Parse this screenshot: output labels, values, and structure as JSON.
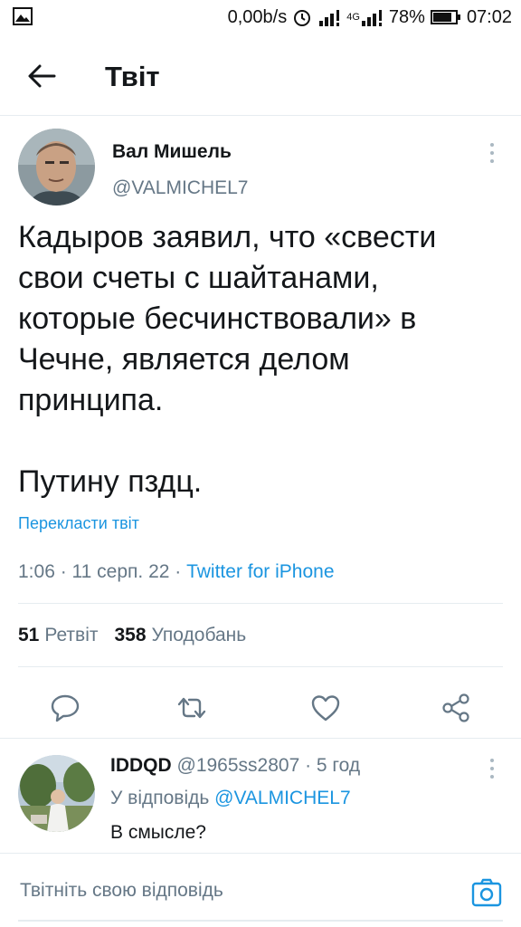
{
  "status_bar": {
    "speed": "0,00b/s",
    "network_label": "4G",
    "battery_percent": "78%",
    "time": "07:02",
    "icons": [
      "image-icon",
      "alarm-icon",
      "signal-icon",
      "signal-4g-icon",
      "battery-icon"
    ]
  },
  "header": {
    "title": "Твіт",
    "back_icon": "arrow-left-icon"
  },
  "tweet": {
    "author_name": "Вал Мишель",
    "author_handle": "@VALMICHEL7",
    "text": "Кадыров заявил, что «свести свои счеты с шайтанами, которые бесчинствовали» в Чечне, является делом принципа.\n\nПутину пздц.",
    "translate_label": "Перекласти твіт",
    "meta_time": "1:06 · 11 серп. 22 · ",
    "meta_client": "Twitter for iPhone",
    "retweets_count": "51",
    "retweets_label": "Ретвіт",
    "likes_count": "358",
    "likes_label": "Уподобань",
    "action_icons": [
      "reply-icon",
      "retweet-icon",
      "like-icon",
      "share-icon"
    ]
  },
  "reply": {
    "author_name": "IDDQD",
    "author_handle_time": " @1965ss2807 · 5 год",
    "in_reply_prefix": "У відповідь ",
    "in_reply_mention": "@VALMICHEL7",
    "text": "В смысле?"
  },
  "compose": {
    "placeholder": "Твітніть свою відповідь",
    "camera_icon": "camera-icon"
  },
  "colors": {
    "accent": "#1b95e0",
    "secondary_text": "#657786",
    "divider": "#e6ecf0"
  }
}
